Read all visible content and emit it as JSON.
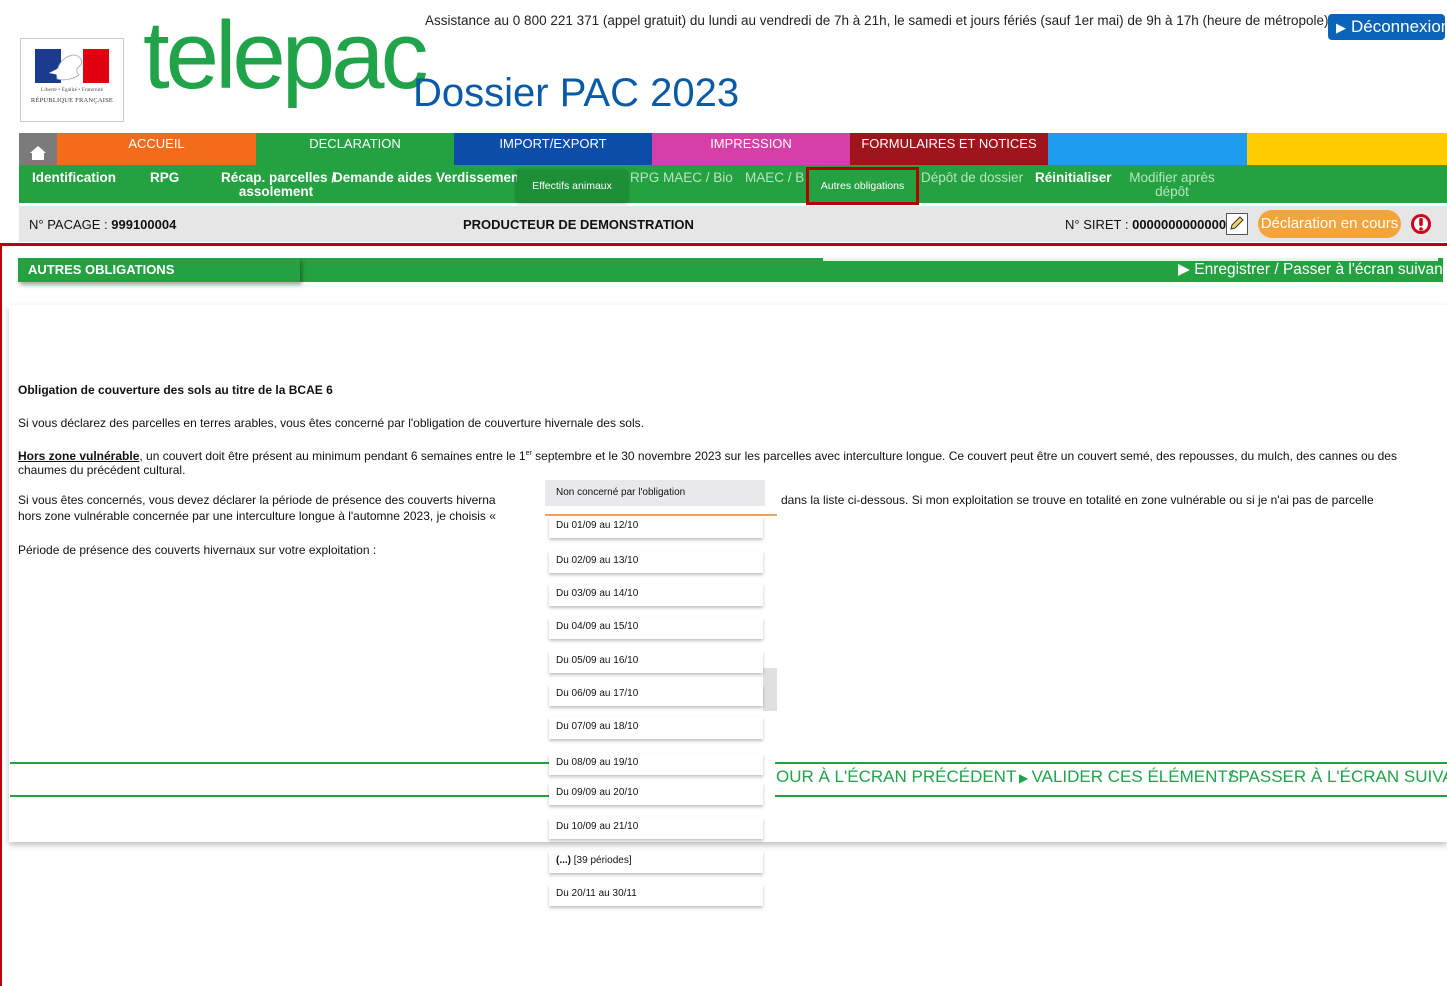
{
  "header": {
    "assistance": "Assistance au 0 800 221 371 (appel gratuit) du lundi au vendredi de 7h à 21h, le samedi et jours fériés (sauf 1er mai) de 9h à 17h (heure de métropole).",
    "logout_label": "Déconnexion",
    "logo_text": "telepac",
    "dossier_title": "Dossier PAC 2023",
    "marianne_motto": "Liberté • Égalité • Fraternité",
    "marianne_rf": "RÉPUBLIQUE FRANÇAISE"
  },
  "main_nav": [
    {
      "label": "ACCUEIL",
      "color": "#f56b1c"
    },
    {
      "label": "DECLARATION",
      "color": "#24a140"
    },
    {
      "label": "IMPORT/EXPORT",
      "color": "#0b4da8"
    },
    {
      "label": "IMPRESSION",
      "color": "#d63ea8"
    },
    {
      "label": "FORMULAIRES ET NOTICES",
      "color": "#a0141b"
    },
    {
      "label": "",
      "color": "#1d9cf0"
    },
    {
      "label": "",
      "color": "#ffcc00"
    }
  ],
  "sub_nav": {
    "identification": "Identification",
    "rpg": "RPG",
    "recap_line1": "Récap. parcelles /",
    "recap_line2": "assolement",
    "demande_aides": "Demande aides",
    "verdissement": "Verdissement",
    "effectifs": "Effectifs animaux",
    "rpg_maec": "RPG MAEC / Bio",
    "maec": "MAEC / Bio",
    "autres": "Autres obligations",
    "depot": "Dépôt de dossier",
    "reinit": "Réinitialiser",
    "modifier_line1": "Modifier après",
    "modifier_line2": "dépôt"
  },
  "info_bar": {
    "pacage_label": "N° PACAGE : ",
    "pacage_value": "999100004",
    "producer": "PRODUCTEUR DE DEMONSTRATION",
    "siret_label": "N° SIRET : ",
    "siret_value": "00000000000000",
    "status": "Déclaration en cours"
  },
  "section": {
    "title": "AUTRES OBLIGATIONS",
    "save_next": "Enregistrer / Passer à l'écran suivant"
  },
  "content": {
    "obligation_title": "Obligation de couverture des sols au titre de la BCAE 6",
    "p1": "Si vous déclarez des parcelles en terres arables, vous êtes concerné par l'obligation de couverture hivernale des sols.",
    "p2_strong": "Hors zone vulnérable",
    "p2_a": ", un couvert doit être présent au minimum pendant 6 semaines entre le 1",
    "p2_sup": "er",
    "p2_b": " septembre et le 30 novembre 2023 sur les parcelles avec interculture longue. Ce couvert peut être un couvert semé, des repousses, du mulch, des cannes ou des chaumes du précédent cultural.",
    "p3_left": "Si vous êtes concernés, vous devez déclarer la période de présence des couverts hiverna",
    "p3_right": "dans la liste ci-dessous. Si mon exploitation se trouve en totalité en zone vulnérable ou si je n'ai pas de parcelle",
    "p3_line2": "hors zone vulnérable concernée par une interculture longue à l'automne 2023, je choisis «",
    "p4": "Période de présence des couverts hivernaux sur votre exploitation :"
  },
  "dropdown": {
    "selected": "Non concerné par l'obligation",
    "options": [
      "Du 01/09 au 12/10",
      "Du 02/09 au 13/10",
      "Du 03/09 au 14/10",
      "Du 04/09 au 15/10",
      "Du 05/09 au 16/10",
      "Du 06/09 au 17/10",
      "Du 07/09 au 18/10",
      "Du 08/09 au 19/10",
      "Du 09/09 au 20/10",
      "Du 10/09 au 21/10"
    ],
    "more_bold": "(...)",
    "more_rest": " [39 périodes]",
    "last": "Du 20/11 au 30/11"
  },
  "bottom": {
    "back": "OUR À L'ÉCRAN PRÉCÉDENT",
    "validate": "VALIDER CES ÉLÉMENTS",
    "next": "/ PASSER À L'ÉCRAN SUIVANT"
  }
}
